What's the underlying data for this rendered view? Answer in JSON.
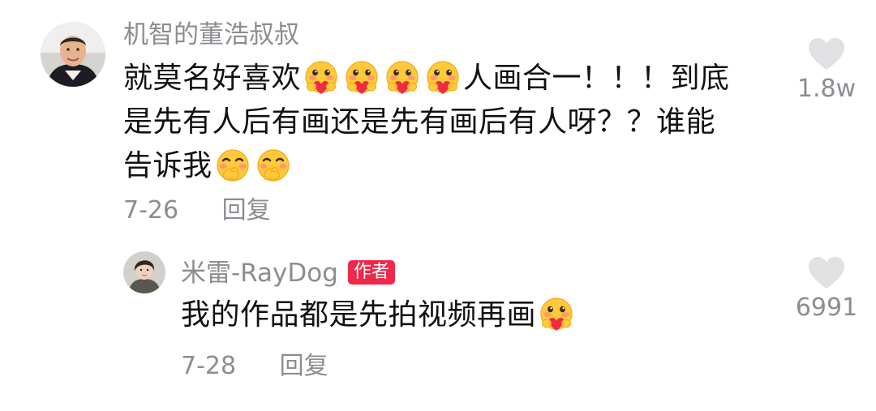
{
  "comment": {
    "username": "机智的董浩叔叔",
    "text_line1_a": "就莫名好喜欢",
    "text_line1_b": "人画合一！！！到底",
    "text_line2": "是先有人后有画还是先有画后有人呀？？谁能",
    "text_line3": "告诉我",
    "date": "7-26",
    "reply_label": "回复",
    "likes": "1.8w",
    "emojis": [
      "heart-hug-emoji",
      "heart-hug-emoji",
      "heart-hug-emoji",
      "heart-hug-emoji",
      "shy-blush-emoji",
      "shy-blush-emoji"
    ]
  },
  "reply": {
    "username": "米雷-RayDog",
    "badge": "作者",
    "text": "我的作品都是先拍视频再画",
    "date": "7-28",
    "reply_label": "回复",
    "likes": "6991",
    "emojis": [
      "heart-hug-emoji"
    ]
  },
  "colors": {
    "meta_gray": "#8c8c92",
    "text": "#111111",
    "badge_red": "#f0284a",
    "heart_gray": "#e1e1e4",
    "emoji_yellow": "#ffc93a",
    "emoji_heart": "#ee2b46"
  }
}
